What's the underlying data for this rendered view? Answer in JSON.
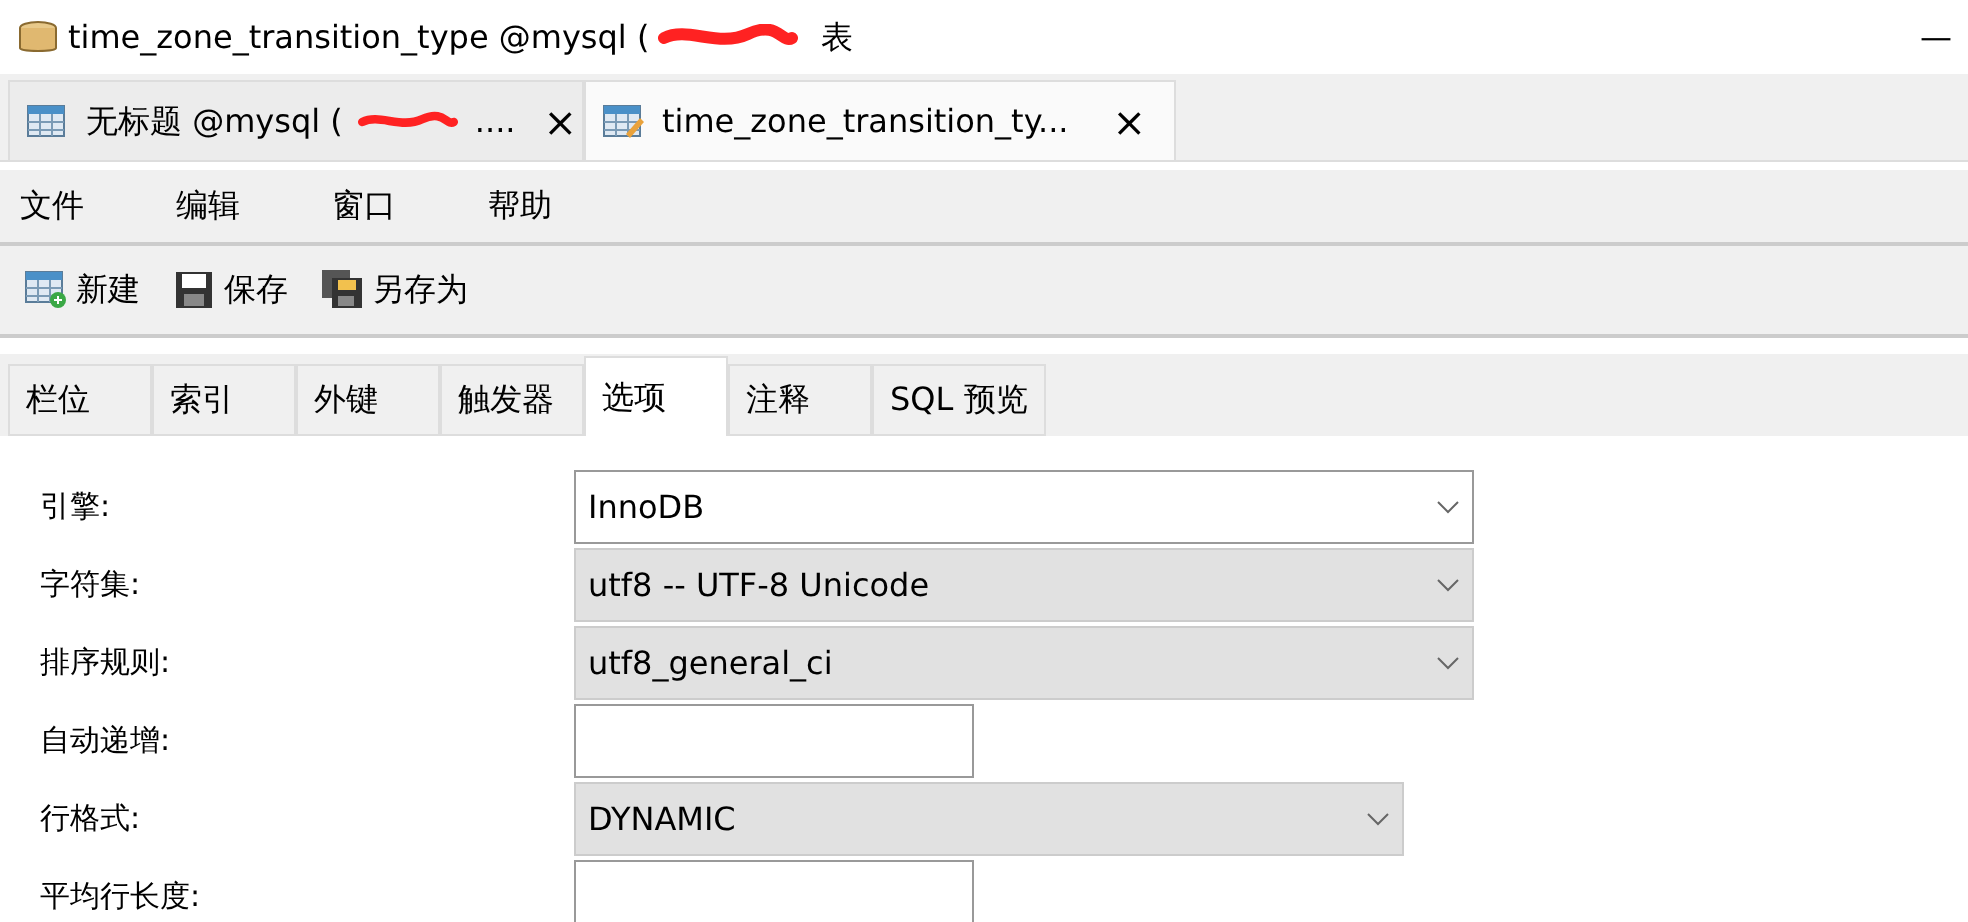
{
  "window": {
    "title": "time_zone_transition_type @mysql (",
    "title_suffix": "表",
    "minimize": "—"
  },
  "doc_tabs": [
    {
      "label": "无标题 @mysql (",
      "trail": "....",
      "selected": false,
      "close": "×"
    },
    {
      "label": "time_zone_transition_ty...",
      "selected": true,
      "close": "×"
    }
  ],
  "menu": [
    "文件",
    "编辑",
    "窗口",
    "帮助"
  ],
  "toolbar": [
    {
      "label": "新建",
      "kind": "new"
    },
    {
      "label": "保存",
      "kind": "save"
    },
    {
      "label": "另存为",
      "kind": "saveas"
    }
  ],
  "tabs": [
    {
      "label": "栏位",
      "selected": false
    },
    {
      "label": "索引",
      "selected": false
    },
    {
      "label": "外键",
      "selected": false
    },
    {
      "label": "触发器",
      "selected": false
    },
    {
      "label": "选项",
      "selected": true
    },
    {
      "label": "注释",
      "selected": false
    },
    {
      "label": "SQL 预览",
      "selected": false
    }
  ],
  "options": [
    {
      "label": "引擎:",
      "kind": "select",
      "value": "InnoDB",
      "disabled": false
    },
    {
      "label": "字符集:",
      "kind": "select",
      "value": "utf8 -- UTF-8 Unicode",
      "disabled": true
    },
    {
      "label": "排序规则:",
      "kind": "select",
      "value": "utf8_general_ci",
      "disabled": true
    },
    {
      "label": "自动递增:",
      "kind": "input"
    },
    {
      "label": "行格式:",
      "kind": "select-short",
      "value": "DYNAMIC",
      "disabled": true
    },
    {
      "label": "平均行长度:",
      "kind": "input"
    }
  ]
}
